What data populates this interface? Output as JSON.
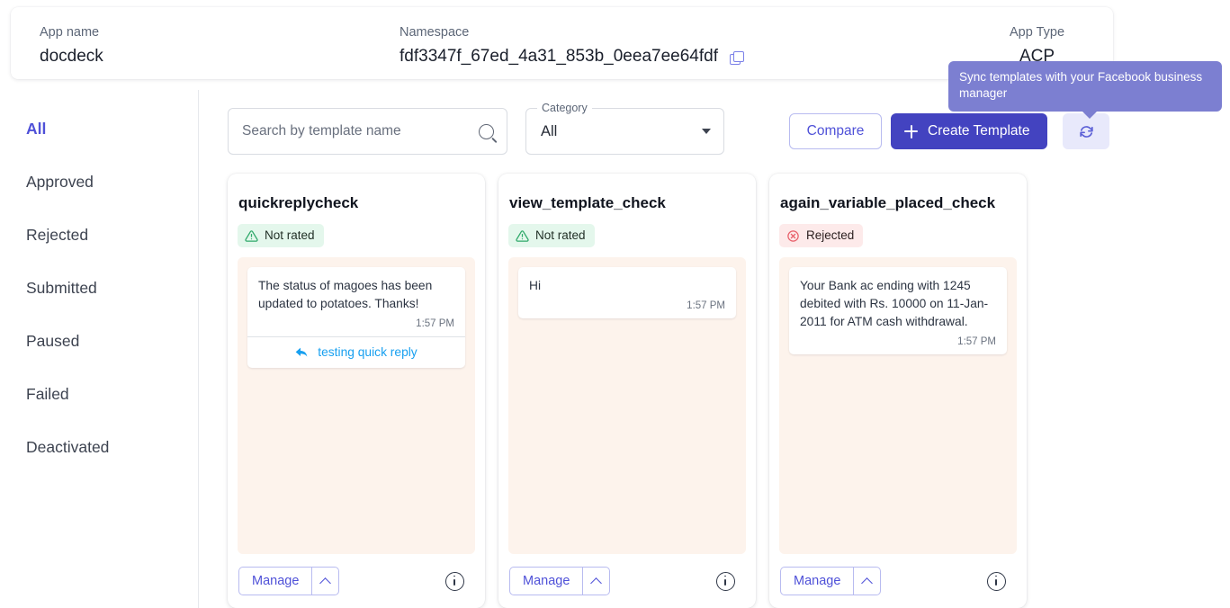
{
  "header": {
    "app_name_label": "App name",
    "app_name_value": "docdeck",
    "namespace_label": "Namespace",
    "namespace_value": "fdf3347f_67ed_4a31_853b_0eea7ee64fdf",
    "copy_icon": "copy-icon",
    "app_type_label": "App Type",
    "app_type_value": "ACP"
  },
  "tooltip": {
    "text": "Sync templates with your Facebook business manager",
    "background": "#7c7fd1"
  },
  "sidebar": {
    "items": [
      {
        "label": "All",
        "active": true
      },
      {
        "label": "Approved",
        "active": false
      },
      {
        "label": "Rejected",
        "active": false
      },
      {
        "label": "Submitted",
        "active": false
      },
      {
        "label": "Paused",
        "active": false
      },
      {
        "label": "Failed",
        "active": false
      },
      {
        "label": "Deactivated",
        "active": false
      }
    ],
    "active_color": "#4f51d8"
  },
  "toolbar": {
    "search_placeholder": "Search by template name",
    "search_value": "",
    "search_icon": "search-icon",
    "category_legend": "Category",
    "category_value": "All",
    "category_options": [
      "All"
    ],
    "compare_label": "Compare",
    "create_label": "Create Template",
    "create_icon": "plus-icon",
    "sync_icon": "sync-refresh-icon",
    "primary_color": "#4343c0",
    "sync_bg": "#e8e9fb"
  },
  "cards": [
    {
      "title": "quickreplycheck",
      "status": "Not rated",
      "status_type": "green",
      "status_icon": "warning-triangle-icon",
      "message": "The status of magoes has been updated to potatoes. Thanks!",
      "time": "1:57 PM",
      "quick_reply": "testing quick reply",
      "has_quick_reply": true,
      "manage_label": "Manage",
      "info_icon": "info-circle-icon"
    },
    {
      "title": "view_template_check",
      "status": "Not rated",
      "status_type": "green",
      "status_icon": "warning-triangle-icon",
      "message": "Hi",
      "time": "1:57 PM",
      "quick_reply": "",
      "has_quick_reply": false,
      "manage_label": "Manage",
      "info_icon": "info-circle-icon"
    },
    {
      "title": "again_variable_placed_check",
      "status": "Rejected",
      "status_type": "red",
      "status_icon": "rejected-circle-icon",
      "message": "Your Bank ac ending with 1245 debited with Rs. 10000 on 11-Jan-2011 for ATM cash withdrawal.",
      "time": "1:57 PM",
      "quick_reply": "",
      "has_quick_reply": false,
      "manage_label": "Manage",
      "info_icon": "info-circle-icon"
    }
  ]
}
